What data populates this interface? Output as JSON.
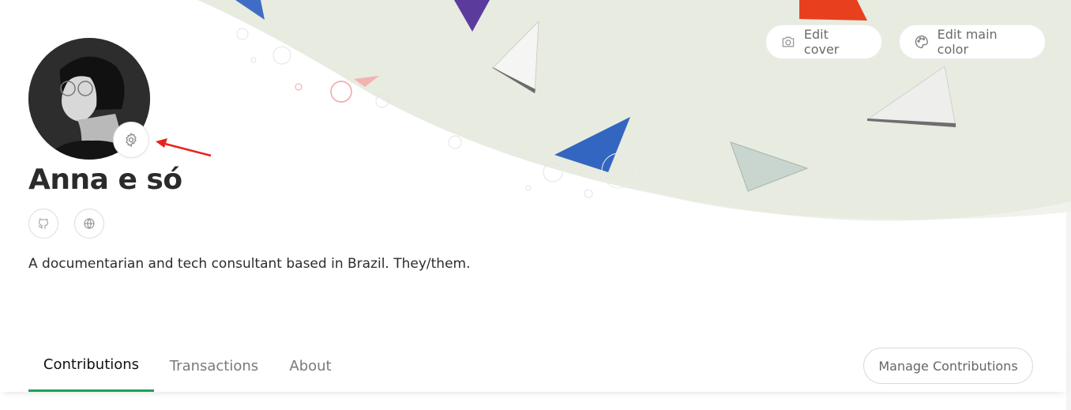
{
  "profile": {
    "name": "Anna e só",
    "bio": "A documentarian and tech consultant based in Brazil. They/them."
  },
  "cover_actions": {
    "edit_cover_label": "Edit cover",
    "edit_color_label": "Edit main color"
  },
  "tabs": [
    {
      "label": "Contributions",
      "active": true
    },
    {
      "label": "Transactions",
      "active": false
    },
    {
      "label": "About",
      "active": false
    }
  ],
  "manage_contributions_label": "Manage Contributions",
  "icons": {
    "avatar_settings": "gear-icon",
    "github": "github-icon",
    "website": "globe-icon",
    "edit_cover": "camera-icon",
    "edit_color": "palette-icon"
  },
  "colors": {
    "active_tab_indicator": "#1fa05a",
    "annotation_arrow": "#e8231c"
  }
}
